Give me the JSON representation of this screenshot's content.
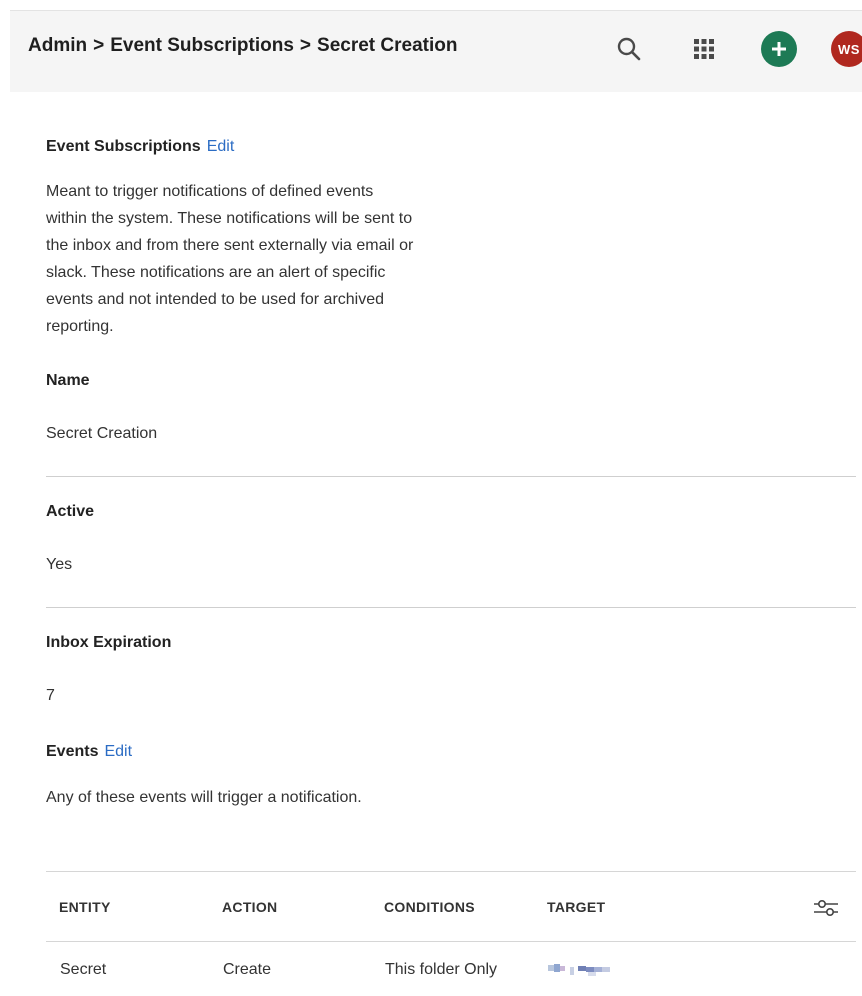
{
  "header": {
    "breadcrumb": [
      "Admin",
      "Event Subscriptions",
      "Secret Creation"
    ],
    "separator": ">",
    "avatar_initials": "WS",
    "icons": [
      "search-icon",
      "apps-grid-icon",
      "add-icon"
    ],
    "accent_color": "#1d7a55",
    "avatar_color": "#b0281f"
  },
  "event_subscriptions": {
    "title": "Event Subscriptions",
    "edit_label": "Edit",
    "description_lines": [
      "Meant to trigger notifications of defined events",
      "within the system. These notifications will be sent to",
      "the inbox and from there sent externally via email or",
      "slack. These notifications are an alert of specific",
      "events and not intended to be used for archived",
      "reporting."
    ]
  },
  "fields": {
    "name_label": "Name",
    "name_value": "Secret Creation",
    "active_label": "Active",
    "active_value": "Yes",
    "inbox_expiration_label": "Inbox Expiration",
    "inbox_expiration_value": "7"
  },
  "events": {
    "title": "Events",
    "edit_label": "Edit",
    "description": "Any of these events will trigger a notification.",
    "table": {
      "columns": [
        "ENTITY",
        "ACTION",
        "CONDITIONS",
        "TARGET"
      ],
      "rows": [
        {
          "entity": "Secret",
          "action": "Create",
          "conditions": "This folder Only"
        }
      ]
    }
  },
  "link_color": "#2b6cc4"
}
